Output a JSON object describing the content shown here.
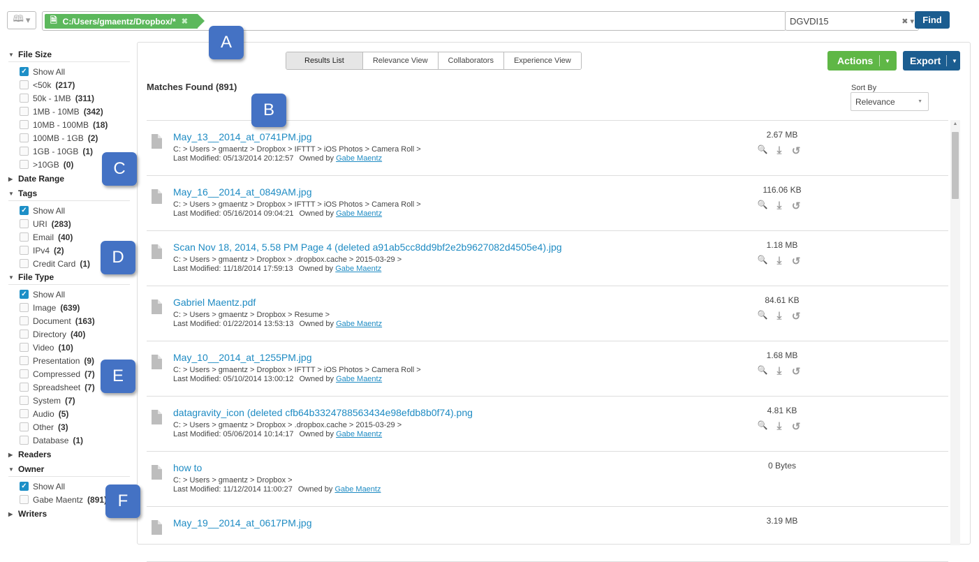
{
  "search": {
    "book_caret": "▾",
    "query_tag": "C:/Users/gmaentz/Dropbox/*",
    "server": "DGVDI15",
    "find_label": "Find"
  },
  "sidebar": {
    "file_size": {
      "title": "File Size",
      "options": [
        {
          "label": "Show All",
          "count": "",
          "checked": true
        },
        {
          "label": "<50k",
          "count": "(217)",
          "checked": false
        },
        {
          "label": "50k - 1MB",
          "count": "(311)",
          "checked": false
        },
        {
          "label": "1MB - 10MB",
          "count": "(342)",
          "checked": false
        },
        {
          "label": "10MB - 100MB",
          "count": "(18)",
          "checked": false
        },
        {
          "label": "100MB - 1GB",
          "count": "(2)",
          "checked": false
        },
        {
          "label": "1GB - 10GB",
          "count": "(1)",
          "checked": false
        },
        {
          "label": ">10GB",
          "count": "(0)",
          "checked": false
        }
      ]
    },
    "date_range": {
      "title": "Date Range"
    },
    "tags": {
      "title": "Tags",
      "options": [
        {
          "label": "Show All",
          "count": "",
          "checked": true
        },
        {
          "label": "URI",
          "count": "(283)",
          "checked": false
        },
        {
          "label": "Email",
          "count": "(40)",
          "checked": false
        },
        {
          "label": "IPv4",
          "count": "(2)",
          "checked": false
        },
        {
          "label": "Credit Card",
          "count": "(1)",
          "checked": false
        }
      ]
    },
    "file_type": {
      "title": "File Type",
      "options": [
        {
          "label": "Show All",
          "count": "",
          "checked": true
        },
        {
          "label": "Image",
          "count": "(639)",
          "checked": false
        },
        {
          "label": "Document",
          "count": "(163)",
          "checked": false
        },
        {
          "label": "Directory",
          "count": "(40)",
          "checked": false
        },
        {
          "label": "Video",
          "count": "(10)",
          "checked": false
        },
        {
          "label": "Presentation",
          "count": "(9)",
          "checked": false
        },
        {
          "label": "Compressed",
          "count": "(7)",
          "checked": false
        },
        {
          "label": "Spreadsheet",
          "count": "(7)",
          "checked": false
        },
        {
          "label": "System",
          "count": "(7)",
          "checked": false
        },
        {
          "label": "Audio",
          "count": "(5)",
          "checked": false
        },
        {
          "label": "Other",
          "count": "(3)",
          "checked": false
        },
        {
          "label": "Database",
          "count": "(1)",
          "checked": false
        }
      ]
    },
    "readers": {
      "title": "Readers"
    },
    "owner": {
      "title": "Owner",
      "options": [
        {
          "label": "Show All",
          "count": "",
          "checked": true
        },
        {
          "label": "Gabe Maentz",
          "count": "(891)",
          "checked": false
        }
      ]
    },
    "writers": {
      "title": "Writers"
    }
  },
  "callouts": [
    "A",
    "B",
    "C",
    "D",
    "E",
    "F"
  ],
  "tabs": [
    "Results List",
    "Relevance View",
    "Collaborators",
    "Experience View"
  ],
  "actions_label": "Actions",
  "export_label": "Export",
  "matches_label": "Matches Found (891)",
  "sort": {
    "label": "Sort By",
    "value": "Relevance"
  },
  "results": [
    {
      "name": "May_13__2014_at_0741PM.jpg",
      "path": "C: > Users > gmaentz > Dropbox > IFTTT > iOS Photos > Camera Roll >",
      "modified": "Last Modified: 05/13/2014 20:12:57",
      "owned_by": "Owned by",
      "owner": "Gabe Maentz",
      "size": "2.67 MB",
      "icons": true
    },
    {
      "name": "May_16__2014_at_0849AM.jpg",
      "path": "C: > Users > gmaentz > Dropbox > IFTTT > iOS Photos > Camera Roll >",
      "modified": "Last Modified: 05/16/2014 09:04:21",
      "owned_by": "Owned by",
      "owner": "Gabe Maentz",
      "size": "116.06 KB",
      "icons": true
    },
    {
      "name": "Scan Nov 18, 2014, 5.58 PM Page 4 (deleted a91ab5cc8dd9bf2e2b9627082d4505e4).jpg",
      "path": "C: > Users > gmaentz > Dropbox > .dropbox.cache > 2015-03-29 >",
      "modified": "Last Modified: 11/18/2014 17:59:13",
      "owned_by": "Owned by",
      "owner": "Gabe Maentz",
      "size": "1.18 MB",
      "icons": true
    },
    {
      "name": "Gabriel Maentz.pdf",
      "path": "C: > Users > gmaentz > Dropbox > Resume >",
      "modified": "Last Modified: 01/22/2014 13:53:13",
      "owned_by": "Owned by",
      "owner": "Gabe Maentz",
      "size": "84.61 KB",
      "icons": true
    },
    {
      "name": "May_10__2014_at_1255PM.jpg",
      "path": "C: > Users > gmaentz > Dropbox > IFTTT > iOS Photos > Camera Roll >",
      "modified": "Last Modified: 05/10/2014 13:00:12",
      "owned_by": "Owned by",
      "owner": "Gabe Maentz",
      "size": "1.68 MB",
      "icons": true
    },
    {
      "name": "datagravity_icon (deleted cfb64b3324788563434e98efdb8b0f74).png",
      "path": "C: > Users > gmaentz > Dropbox > .dropbox.cache > 2015-03-29 >",
      "modified": "Last Modified: 05/06/2014 10:14:17",
      "owned_by": "Owned by",
      "owner": "Gabe Maentz",
      "size": "4.81 KB",
      "icons": true
    },
    {
      "name": "how to",
      "path": "C: > Users > gmaentz > Dropbox >",
      "modified": "Last Modified: 11/12/2014 11:00:27",
      "owned_by": "Owned by",
      "owner": "Gabe Maentz",
      "size": "0 Bytes",
      "icons": false
    },
    {
      "name": "May_19__2014_at_0617PM.jpg",
      "path": "",
      "modified": "",
      "owned_by": "",
      "owner": "",
      "size": "3.19 MB",
      "icons": false
    }
  ],
  "icons": {
    "preview": "preview-icon",
    "download": "download-icon",
    "restore": "restore-icon"
  }
}
